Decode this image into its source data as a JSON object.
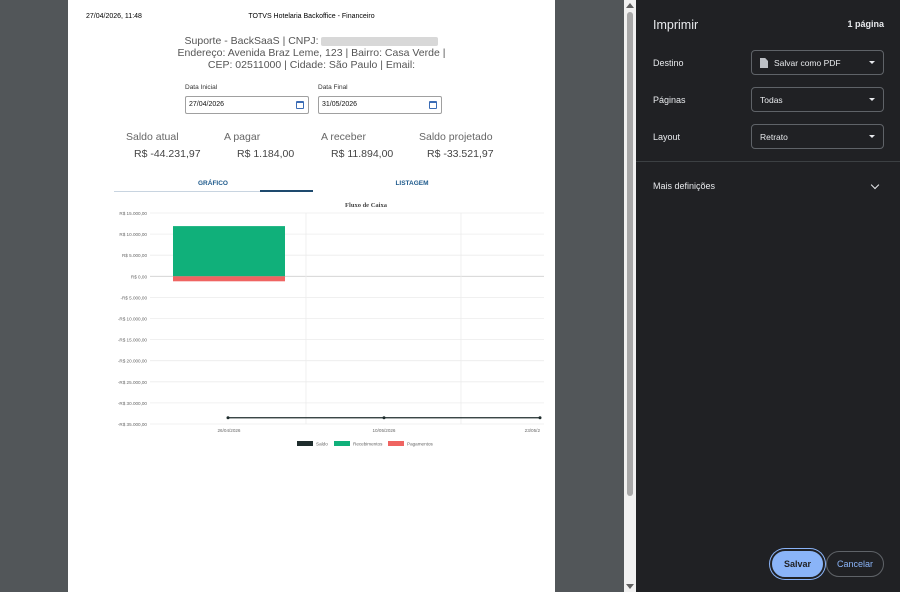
{
  "preview": {
    "header_date": "27/04/2026, 11:48",
    "header_title": "TOTVS Hotelaria Backoffice - Financeiro",
    "company_line1_prefix": "Suporte - BackSaaS | CNPJ:",
    "company_line2": "Endereço: Avenida Braz Leme, 123 | Bairro: Casa Verde |",
    "company_line3": "CEP: 02511000 | Cidade: São Paulo | Email:",
    "data_inicial_label": "Data Inicial",
    "data_inicial_value": "27/04/2026",
    "data_final_label": "Data Final",
    "data_final_value": "31/05/2026",
    "summary": [
      {
        "label": "Saldo atual",
        "value": "R$ -44.231,97"
      },
      {
        "label": "A pagar",
        "value": "R$ 1.184,00"
      },
      {
        "label": "A receber",
        "value": "R$ 11.894,00"
      },
      {
        "label": "Saldo projetado",
        "value": "R$ -33.521,97"
      }
    ],
    "tabs": [
      "GRÁFICO",
      "LISTAGEM"
    ]
  },
  "chart_data": {
    "type": "bar",
    "title": "Fluxo de Caixa",
    "y_ticks": [
      "R$ 15.000,00",
      "R$ 10.000,00",
      "R$ 5.000,00",
      "R$ 0,00",
      "-R$ 5.000,00",
      "-R$ 10.000,00",
      "-R$ 15.000,00",
      "-R$ 20.000,00",
      "-R$ 25.000,00",
      "-R$ 30.000,00",
      "-R$ 35.000,00"
    ],
    "ylim": [
      -35000,
      15000
    ],
    "x_ticks": [
      "26/04/2026",
      "10/05/2026",
      "23/05/2"
    ],
    "series": [
      {
        "name": "Saldo",
        "type": "line",
        "color": "#1f2d2d",
        "values": [
          -33521.97,
          -33521.97,
          -33521.97
        ]
      },
      {
        "name": "Recebimentos",
        "type": "bar",
        "color": "#10b07a",
        "values": [
          11894,
          0,
          0
        ]
      },
      {
        "name": "Pagamentos",
        "type": "bar",
        "color": "#ef6461",
        "values": [
          -1184,
          0,
          0
        ]
      }
    ],
    "legend_position": "bottom"
  },
  "side": {
    "title": "Imprimir",
    "page_count": "1 página",
    "destino_label": "Destino",
    "destino_value": "Salvar como PDF",
    "paginas_label": "Páginas",
    "paginas_value": "Todas",
    "layout_label": "Layout",
    "layout_value": "Retrato",
    "more_settings": "Mais definições",
    "save_label": "Salvar",
    "cancel_label": "Cancelar"
  }
}
